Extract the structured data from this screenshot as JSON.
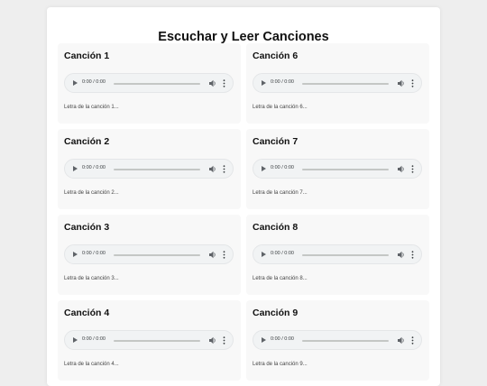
{
  "page": {
    "title": "Escuchar y Leer Canciones"
  },
  "songs": [
    {
      "title": "Canción 1",
      "time": "0:00 / 0:00",
      "lyrics": "Letra de la canción 1..."
    },
    {
      "title": "Canción 6",
      "time": "0:00 / 0:00",
      "lyrics": "Letra de la canción 6..."
    },
    {
      "title": "Canción 2",
      "time": "0:00 / 0:00",
      "lyrics": "Letra de la canción 2..."
    },
    {
      "title": "Canción 7",
      "time": "0:00 / 0:00",
      "lyrics": "Letra de la canción 7..."
    },
    {
      "title": "Canción 3",
      "time": "0:00 / 0:00",
      "lyrics": "Letra de la canción 3..."
    },
    {
      "title": "Canción 8",
      "time": "0:00 / 0:00",
      "lyrics": "Letra de la canción 8..."
    },
    {
      "title": "Canción 4",
      "time": "0:00 / 0:00",
      "lyrics": "Letra de la canción 4..."
    },
    {
      "title": "Canción 9",
      "time": "0:00 / 0:00",
      "lyrics": "Letra de la canción 9..."
    }
  ]
}
